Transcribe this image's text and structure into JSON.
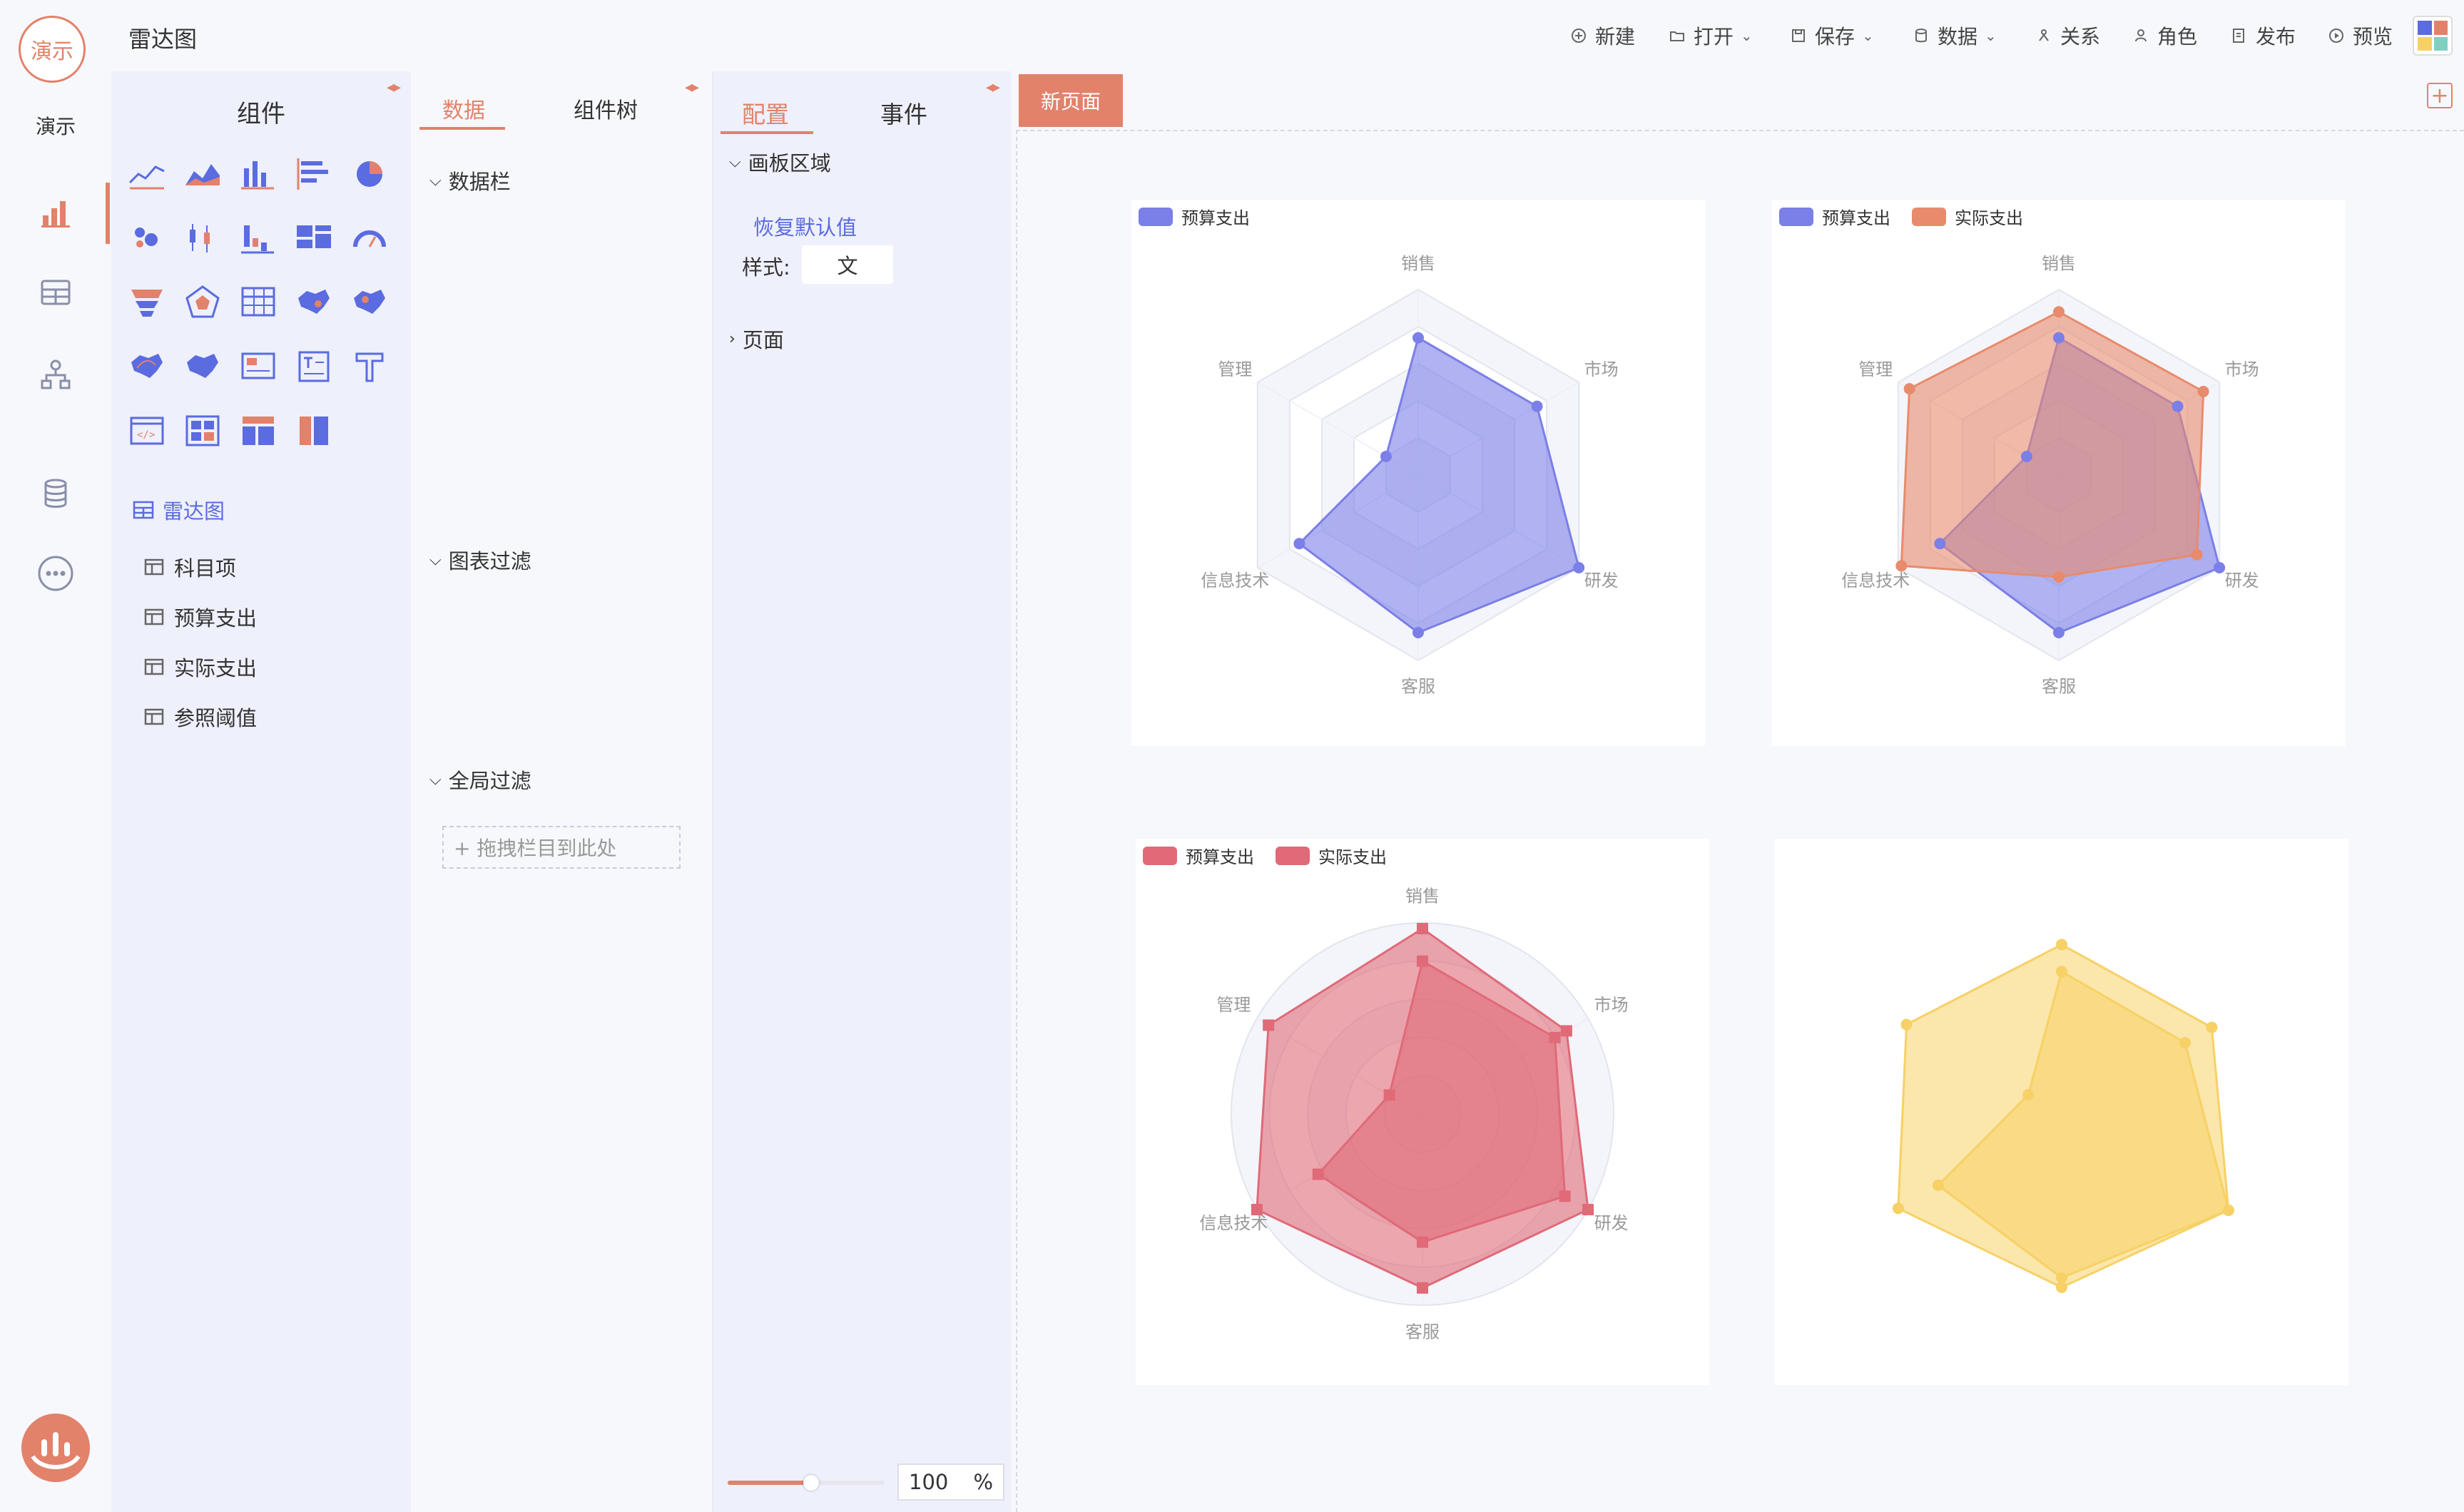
{
  "app": {
    "title": "雷达图",
    "avatar_text": "演示",
    "user_label": "演示"
  },
  "toolbar": {
    "new_label": "新建",
    "open_label": "打开",
    "save_label": "保存",
    "data_label": "数据",
    "relation_label": "关系",
    "role_label": "角色",
    "publish_label": "发布",
    "preview_label": "预览"
  },
  "components": {
    "title": "组件",
    "tree_root": "雷达图",
    "tree_items": [
      "科目项",
      "预算支出",
      "实际支出",
      "参照阈值"
    ]
  },
  "data_panel": {
    "tabs": [
      "数据",
      "组件树"
    ],
    "sections": {
      "data_bar": "数据栏",
      "chart_filter": "图表过滤",
      "global_filter": "全局过滤"
    },
    "drop_placeholder": "+ 拖拽栏目到此处"
  },
  "config_panel": {
    "tabs": [
      "配置",
      "事件"
    ],
    "canvas_section": "画板区域",
    "restore_default": "恢复默认值",
    "style_label": "样式:",
    "style_value": "文",
    "page_section": "页面",
    "zoom_value": "100",
    "zoom_unit": "%",
    "zoom_fraction": 0.5
  },
  "canvas": {
    "page_tab": "新页面",
    "add_icon": "+"
  },
  "colors": {
    "accent": "#e2826a",
    "link": "#5b6be0",
    "budget_blue": "#7b7fe8",
    "actual_orange": "#e88b6d",
    "red": "#e06a78",
    "yellow": "#f7d166"
  },
  "chart_data": [
    {
      "type": "radar",
      "indicators": [
        "销售",
        "市场",
        "研发",
        "客服",
        "信息技术",
        "管理"
      ],
      "legend": [
        "预算支出"
      ],
      "series": [
        {
          "name": "预算支出",
          "values": [
            0.74,
            0.74,
            1.0,
            0.85,
            0.74,
            0.2
          ],
          "color": "#7b7fe8"
        }
      ]
    },
    {
      "type": "radar",
      "indicators": [
        "销售",
        "市场",
        "研发",
        "客服",
        "信息技术",
        "管理"
      ],
      "legend": [
        "预算支出",
        "实际支出"
      ],
      "series": [
        {
          "name": "预算支出",
          "values": [
            0.74,
            0.74,
            1.0,
            0.85,
            0.74,
            0.2
          ],
          "color": "#7b7fe8"
        },
        {
          "name": "实际支出",
          "values": [
            0.88,
            0.9,
            0.86,
            0.55,
            0.98,
            0.93
          ],
          "color": "#e88b6d"
        }
      ]
    },
    {
      "type": "radar",
      "shape": "circle",
      "indicators": [
        "销售",
        "市场",
        "研发",
        "客服",
        "信息技术",
        "管理"
      ],
      "legend": [
        "预算支出",
        "实际支出"
      ],
      "series": [
        {
          "name": "预算支出",
          "values": [
            0.8,
            0.8,
            0.86,
            0.67,
            0.63,
            0.2
          ],
          "color": "#e06a78"
        },
        {
          "name": "实际支出",
          "values": [
            0.97,
            0.87,
            1.0,
            0.91,
            1.0,
            0.93
          ],
          "color": "#e06a78"
        }
      ]
    },
    {
      "type": "radar",
      "indicators": [
        "",
        "",
        "",
        "",
        "",
        ""
      ],
      "legend": [],
      "series": [
        {
          "name": "",
          "values": [
            0.74,
            0.74,
            1.0,
            0.85,
            0.74,
            0.2
          ],
          "color": "#f7d166"
        },
        {
          "name": "",
          "values": [
            0.88,
            0.9,
            1.0,
            0.9,
            0.98,
            0.93
          ],
          "color": "#f7d166"
        }
      ]
    }
  ]
}
